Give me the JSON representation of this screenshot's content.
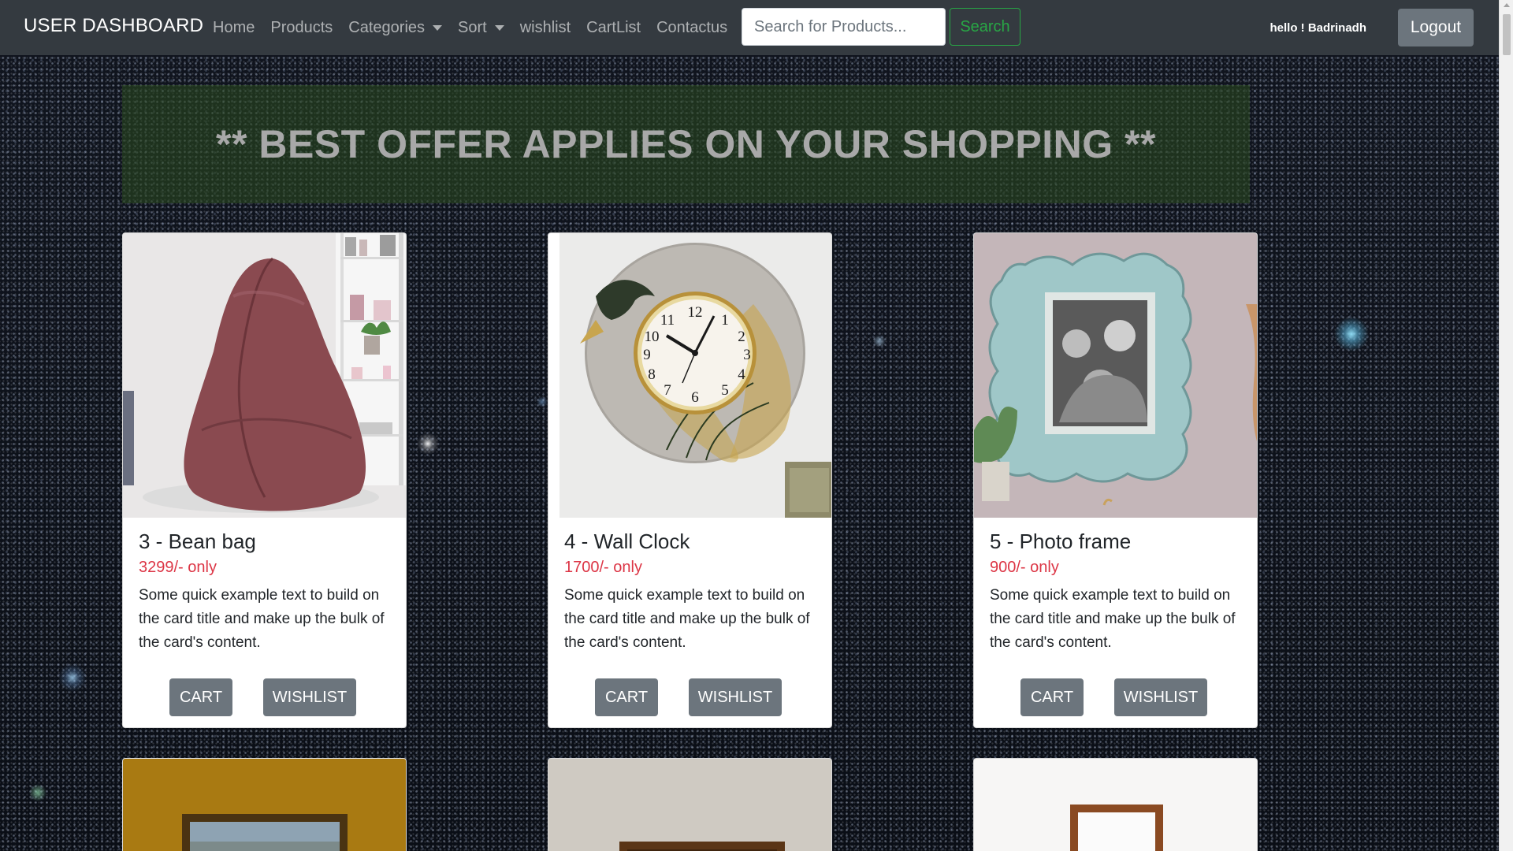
{
  "navbar": {
    "brand": "USER DASHBOARD",
    "links": {
      "home": "Home",
      "products": "Products",
      "categories": "Categories",
      "sort": "Sort",
      "wishlist": "wishlist",
      "cartlist": "CartList",
      "contact": "Contactus"
    },
    "search_placeholder": "Search for Products...",
    "search_button": "Search",
    "greeting": "hello ! Badrinadh",
    "logout": "Logout"
  },
  "banner": {
    "text": "** BEST OFFER APPLIES ON YOUR SHOPPING **"
  },
  "products": [
    {
      "title": "3 - Bean bag",
      "price": "3299/- only",
      "description": "Some quick example text to build on the card title and make up the bulk of the card's content.",
      "cart_label": "CART",
      "wishlist_label": "WISHLIST"
    },
    {
      "title": "4 - Wall Clock",
      "price": "1700/- only",
      "description": "Some quick example text to build on the card title and make up the bulk of the card's content.",
      "cart_label": "CART",
      "wishlist_label": "WISHLIST"
    },
    {
      "title": "5 - Photo frame",
      "price": "900/- only",
      "description": "Some quick example text to build on the card title and make up the bulk of the card's content.",
      "cart_label": "CART",
      "wishlist_label": "WISHLIST"
    }
  ],
  "colors": {
    "navbar": "#343a40",
    "price": "#dc3545",
    "search_button": "#28a745",
    "button": "#6c757d"
  }
}
